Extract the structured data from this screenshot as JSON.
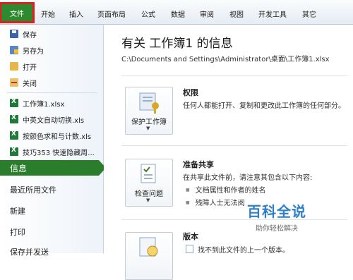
{
  "ribbon": {
    "file_tab": "文件",
    "tabs": [
      "开始",
      "插入",
      "页面布局",
      "公式",
      "数据",
      "审阅",
      "视图",
      "开发工具",
      "其它"
    ]
  },
  "backstage": {
    "commands": [
      {
        "label": "保存",
        "icon": "save-icon"
      },
      {
        "label": "另存为",
        "icon": "save-as-icon"
      },
      {
        "label": "打开",
        "icon": "open-folder-icon"
      },
      {
        "label": "关闭",
        "icon": "close-file-icon"
      }
    ],
    "recent_files": [
      "工作簿1.xlsx",
      "中英文自动切换.xls",
      "按颜色求和与计数.xls",
      "技巧353 快速隐藏周..."
    ],
    "nav": {
      "info": "信息",
      "recent": "最近所用文件",
      "new": "新建",
      "print": "打印",
      "save_send": "保存并发送"
    }
  },
  "info": {
    "title": "有关 工作簿1 的信息",
    "path": "C:\\Documents and Settings\\Administrator\\桌面\\工作簿1.xlsx",
    "permissions": {
      "button": "保护工作簿",
      "heading": "权限",
      "text": "任何人都能打开、复制和更改此工作簿的任何部分。"
    },
    "prepare": {
      "button": "检查问题",
      "heading": "准备共享",
      "text": "在共享此文件前，请注意其包含以下内容:",
      "bullets": [
        "文档属性和作者的姓名",
        "残障人士无法阅"
      ]
    },
    "versions": {
      "heading": "版本",
      "text": "找不到此文件的上一个版本。"
    }
  },
  "watermark": {
    "title": "百科全说",
    "subtitle": "助你轻松解决"
  },
  "colors": {
    "file_tab": "#2f8a2f",
    "highlight": "#e02020",
    "selected_nav": "#2a7d2a",
    "watermark": "#2f80c8"
  }
}
